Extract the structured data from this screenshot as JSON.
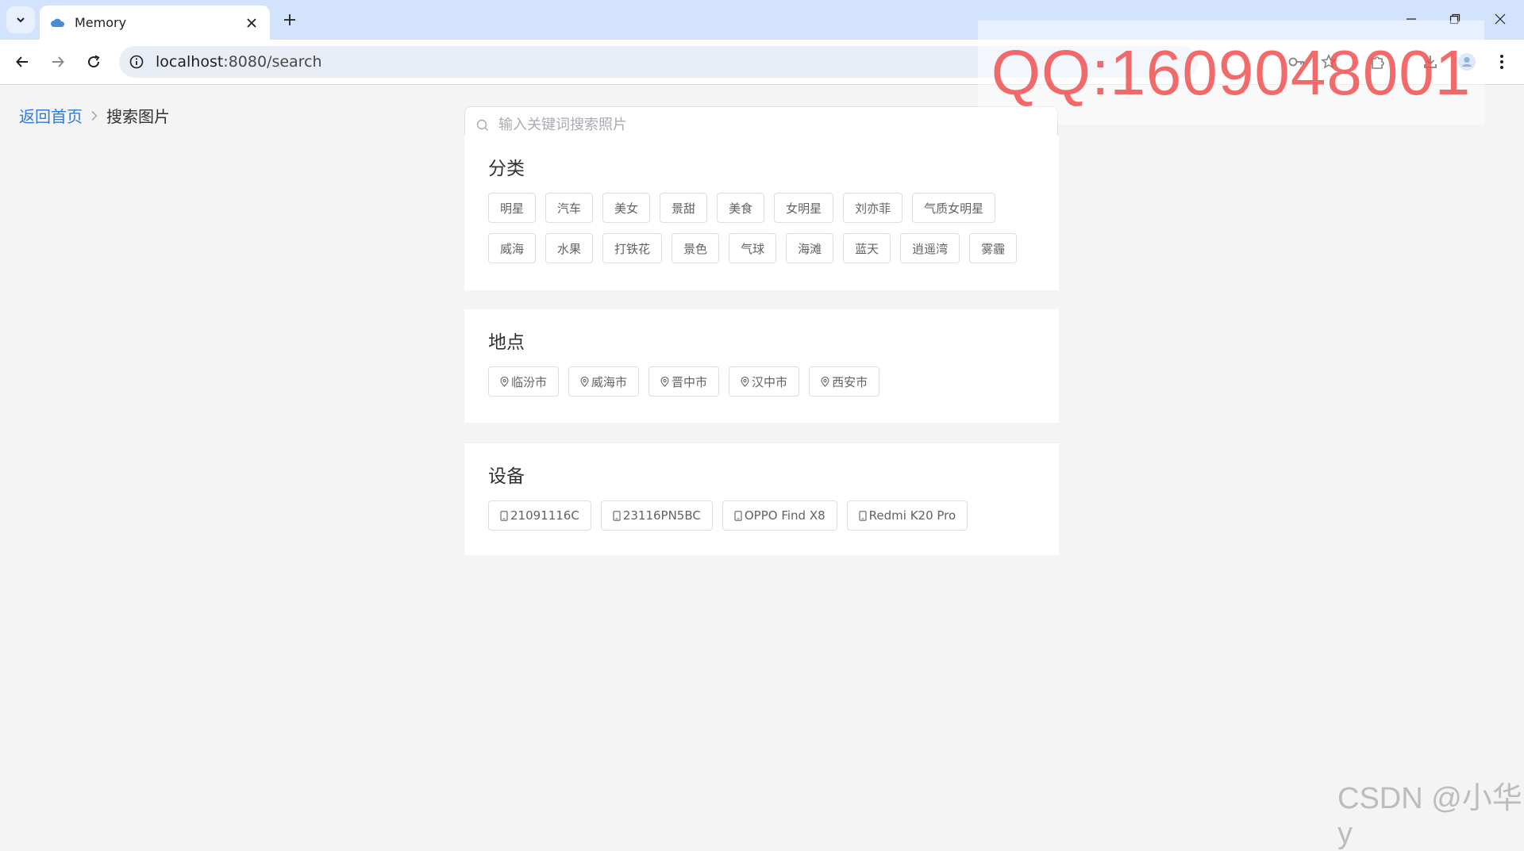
{
  "browser": {
    "tab": {
      "title": "Memory",
      "favicon": "cloud-icon"
    },
    "url_host": "localhost",
    "url_rest": ":8080/search"
  },
  "breadcrumb": {
    "home": "返回首页",
    "current": "搜索图片"
  },
  "search": {
    "placeholder": "输入关键词搜索照片",
    "value": ""
  },
  "sections": {
    "category": {
      "title": "分类",
      "tags": [
        "明星",
        "汽车",
        "美女",
        "景甜",
        "美食",
        "女明星",
        "刘亦菲",
        "气质女明星",
        "威海",
        "水果",
        "打铁花",
        "景色",
        "气球",
        "海滩",
        "蓝天",
        "逍遥湾",
        "雾霾"
      ]
    },
    "location": {
      "title": "地点",
      "icon": "location-pin-icon",
      "tags": [
        "临汾市",
        "威海市",
        "晋中市",
        "汉中市",
        "西安市"
      ]
    },
    "device": {
      "title": "设备",
      "icon": "phone-icon",
      "tags": [
        "21091116C",
        "23116PN5BC",
        "OPPO Find X8",
        "Redmi K20 Pro"
      ]
    }
  },
  "watermarks": {
    "qq": "QQ:1609048001",
    "csdn": "CSDN @小华y"
  },
  "colors": {
    "link": "#2f7bd9",
    "tabstrip": "#d3e3fd",
    "page_bg": "#f4f4f4",
    "qq_text": "#f05050"
  }
}
